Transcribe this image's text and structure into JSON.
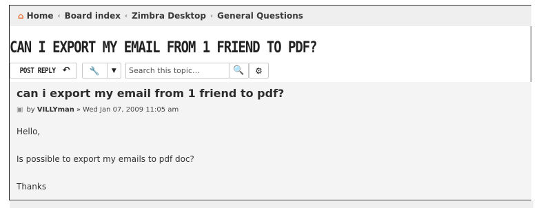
{
  "breadcrumb": {
    "items": [
      {
        "label": "Home"
      },
      {
        "label": "Board index"
      },
      {
        "label": "Zimbra Desktop"
      },
      {
        "label": "General Questions"
      }
    ],
    "separator": "‹"
  },
  "topic": {
    "title": "CAN I EXPORT MY EMAIL FROM 1 FRIEND TO PDF?"
  },
  "toolbar": {
    "post_reply_label": "POST REPLY",
    "search_placeholder": "Search this topic…"
  },
  "post": {
    "title": "can i export my email from 1 friend to pdf?",
    "by_label": "by",
    "author": "VILLYman",
    "date_sep": "»",
    "date": "Wed Jan 07, 2009 11:05 am",
    "body": [
      "Hello,",
      "Is possible to export my emails to pdf doc?",
      "Thanks"
    ]
  },
  "colors": {
    "accent": "#e5682a",
    "panel": "#f4f4f4",
    "breadcrumb_bg": "#efefef"
  }
}
